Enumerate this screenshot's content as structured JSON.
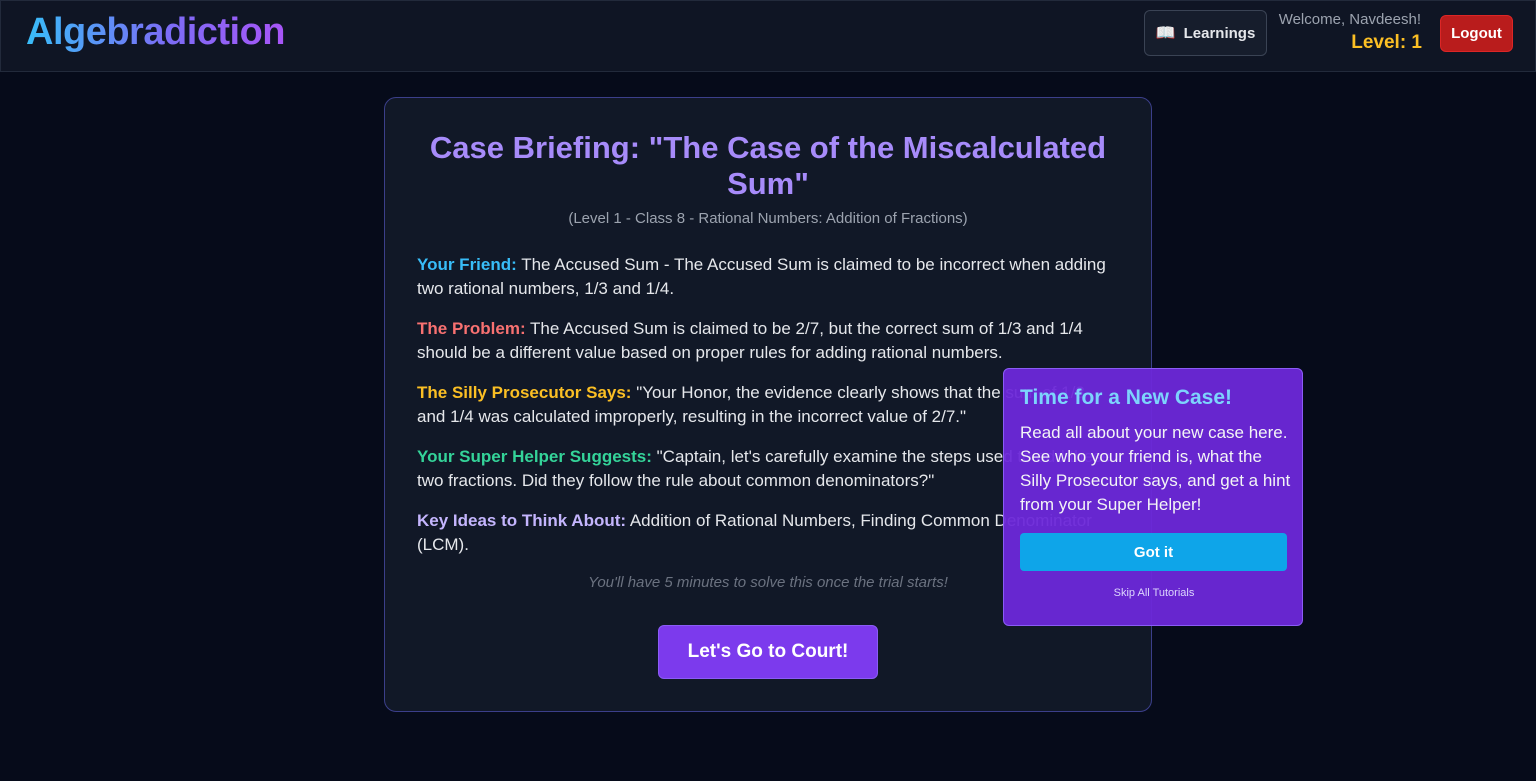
{
  "header": {
    "logo": "Algebradiction",
    "learnings_icon": "book-icon",
    "learnings_label": "Learnings",
    "welcome": "Welcome, Navdeesh!",
    "level": "Level: 1",
    "logout_label": "Logout"
  },
  "case": {
    "title": "Case Briefing: \"The Case of the Miscalculated Sum\"",
    "subtitle": "(Level 1 - Class 8 - Rational Numbers: Addition of Fractions)",
    "friend_label": "Your Friend:",
    "friend_text": " The Accused Sum - The Accused Sum is claimed to be incorrect when adding two rational numbers, 1/3 and 1/4.",
    "problem_label": "The Problem:",
    "problem_text": " The Accused Sum is claimed to be 2/7, but the correct sum of 1/3 and 1/4 should be a different value based on proper rules for adding rational numbers.",
    "prosecutor_label": "The Silly Prosecutor Says:",
    "prosecutor_text": " \"Your Honor, the evidence clearly shows that the sum of 1/3 and 1/4 was calculated improperly, resulting in the incorrect value of 2/7.\"",
    "helper_label": "Your Super Helper Suggests:",
    "helper_text": " \"Captain, let's carefully examine the steps used to add these two fractions. Did they follow the rule about common denominators?\"",
    "key_label": "Key Ideas to Think About:",
    "key_text": " Addition of Rational Numbers, Finding Common Denominator (LCM).",
    "timer_note": "You'll have 5 minutes to solve this once the trial starts!",
    "court_button": "Let's Go to Court!"
  },
  "tutorial": {
    "title": "Time for a New Case!",
    "body": "Read all about your new case here. See who your friend is, what the Silly Prosecutor says, and get a hint from your Super Helper!",
    "got_it": "Got it",
    "skip": "Skip All Tutorials"
  }
}
